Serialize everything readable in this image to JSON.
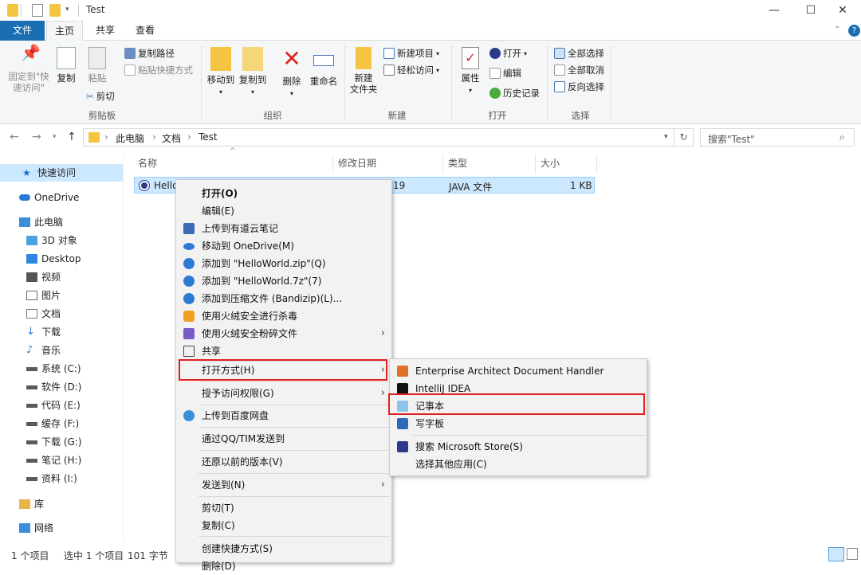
{
  "window": {
    "title": "Test",
    "controls": {
      "minimize": "—",
      "maximize": "☐",
      "close": "✕"
    }
  },
  "ribbon_tabs": [
    {
      "label": "文件"
    },
    {
      "label": "主页"
    },
    {
      "label": "共享"
    },
    {
      "label": "查看"
    }
  ],
  "ribbon": {
    "clipboard": {
      "pin_label": "固定到\"快速访问\"",
      "pin_line1": "固定到\"快",
      "pin_line2": "速访问\"",
      "copy": "复制",
      "paste": "粘贴",
      "copy_path": "复制路径",
      "paste_shortcut": "粘贴快捷方式",
      "cut": "剪切",
      "group": "剪贴板"
    },
    "organize": {
      "move_to": "移动到",
      "copy_to": "复制到",
      "delete": "删除",
      "rename": "重命名",
      "group": "组织"
    },
    "new": {
      "new_folder_1": "新建",
      "new_folder_2": "文件夹",
      "new_item": "新建项目",
      "easy_access": "轻松访问",
      "group": "新建"
    },
    "open": {
      "properties": "属性",
      "open": "打开",
      "edit": "编辑",
      "history": "历史记录",
      "group": "打开"
    },
    "select": {
      "select_all": "全部选择",
      "select_none": "全部取消",
      "invert": "反向选择",
      "group": "选择"
    }
  },
  "address": {
    "crumbs": [
      "此电脑",
      "文档",
      "Test"
    ],
    "search_placeholder": "搜索\"Test\""
  },
  "sidebar": {
    "items": [
      {
        "label": "快速访问",
        "icon": "star-icon",
        "color": "#1e6fc8"
      },
      {
        "label": "OneDrive",
        "icon": "cloud-icon",
        "color": "#2d7ad6"
      },
      {
        "label": "此电脑",
        "icon": "computer-icon",
        "color": "#3a8fd9"
      },
      {
        "label": "3D 对象",
        "icon": "cube-icon",
        "color": "#4aa3df"
      },
      {
        "label": "Desktop",
        "icon": "desktop-icon",
        "color": "#2d86e0"
      },
      {
        "label": "视频",
        "icon": "video-icon",
        "color": "#555555"
      },
      {
        "label": "图片",
        "icon": "picture-icon",
        "color": "#6a6a6a"
      },
      {
        "label": "文档",
        "icon": "document-icon",
        "color": "#7a7a7a"
      },
      {
        "label": "下载",
        "icon": "download-icon",
        "color": "#2d7ad6"
      },
      {
        "label": "音乐",
        "icon": "music-icon",
        "color": "#2d7ad6"
      },
      {
        "label": "系统 (C:)",
        "icon": "drive-icon",
        "color": "#5a5a5a"
      },
      {
        "label": "软件 (D:)",
        "icon": "drive-icon",
        "color": "#5a5a5a"
      },
      {
        "label": "代码 (E:)",
        "icon": "drive-icon",
        "color": "#5a5a5a"
      },
      {
        "label": "缓存 (F:)",
        "icon": "drive-icon",
        "color": "#5a5a5a"
      },
      {
        "label": "下载 (G:)",
        "icon": "drive-icon",
        "color": "#5a5a5a"
      },
      {
        "label": "笔记 (H:)",
        "icon": "drive-icon",
        "color": "#5a5a5a"
      },
      {
        "label": "资料 (I:)",
        "icon": "drive-icon",
        "color": "#5a5a5a"
      },
      {
        "label": "库",
        "icon": "library-icon",
        "color": "#e7b54a"
      },
      {
        "label": "网络",
        "icon": "network-icon",
        "color": "#3a8fd9"
      }
    ]
  },
  "filelist": {
    "headers": {
      "name": "名称",
      "date": "修改日期",
      "type": "类型",
      "size": "大小"
    },
    "row": {
      "name": "Hello",
      "date": "19",
      "type": "JAVA 文件",
      "size": "1 KB"
    }
  },
  "statusbar": {
    "count": "1 个项目",
    "selected": "选中 1 个项目",
    "size": "101 字节"
  },
  "context_menu": {
    "items": [
      {
        "label": "打开(O)",
        "bold": true
      },
      {
        "label": "编辑(E)"
      },
      {
        "label": "上传到有道云笔记",
        "icon": "youdao-icon"
      },
      {
        "label": "移动到 OneDrive(M)",
        "icon": "onedrive-icon"
      },
      {
        "label": "添加到 \"HelloWorld.zip\"(Q)",
        "icon": "bandizip-icon"
      },
      {
        "label": "添加到 \"HelloWorld.7z\"(7)",
        "icon": "bandizip-icon"
      },
      {
        "label": "添加到压缩文件 (Bandizip)(L)...",
        "icon": "bandizip-icon"
      },
      {
        "label": "使用火绒安全进行杀毒",
        "icon": "huorong-icon"
      },
      {
        "label": "使用火绒安全粉碎文件",
        "icon": "shred-icon"
      },
      {
        "label": "共享",
        "icon": "share-icon"
      },
      {
        "label": "打开方式(H)"
      },
      {
        "label": "授予访问权限(G)"
      },
      {
        "label": "上传到百度网盘",
        "icon": "baidu-icon"
      },
      {
        "label": "通过QQ/TIM发送到"
      },
      {
        "label": "还原以前的版本(V)"
      },
      {
        "label": "发送到(N)"
      },
      {
        "label": "剪切(T)"
      },
      {
        "label": "复制(C)"
      },
      {
        "label": "创建快捷方式(S)"
      },
      {
        "label": "删除(D)"
      }
    ]
  },
  "open_with_menu": {
    "items": [
      {
        "label": "Enterprise Architect Document Handler"
      },
      {
        "label": "IntelliJ IDEA"
      },
      {
        "label": "记事本"
      },
      {
        "label": "写字板"
      },
      {
        "label": "搜索 Microsoft Store(S)"
      },
      {
        "label": "选择其他应用(C)"
      }
    ]
  },
  "colors": {
    "accent": "#1a6fb3",
    "selection": "#cce8ff",
    "highlight_box": "#e02020"
  }
}
